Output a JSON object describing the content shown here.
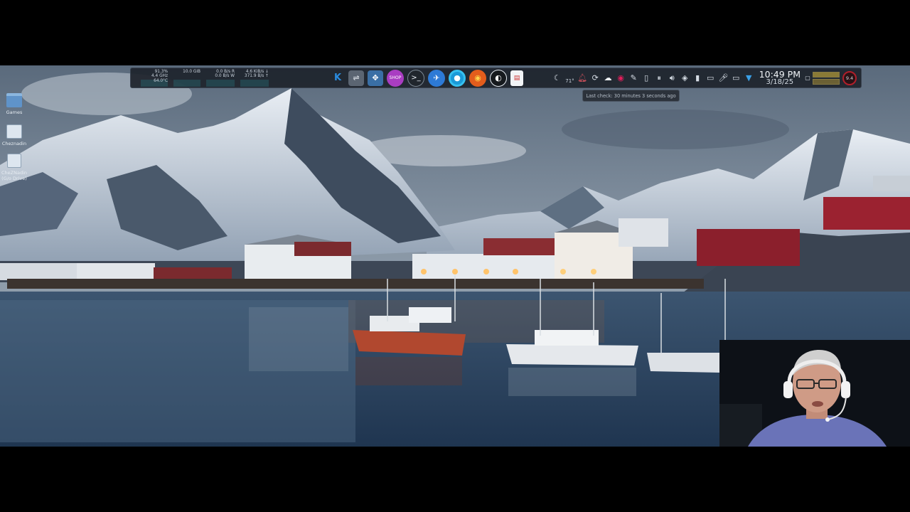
{
  "panel": {
    "system_monitor": {
      "cpu": {
        "usage": "91.3%",
        "freq": "4.4 GHz",
        "temp": "64.0°C"
      },
      "memory": {
        "used": "10.0 GiB"
      },
      "disk": {
        "read": "0.0 B/s R",
        "write": "0.0 B/s W"
      },
      "network": {
        "down": "4.6 KiB/s ↓",
        "up": "371.9 B/s ↑"
      }
    },
    "launchers": [
      {
        "name": "kde-menu",
        "glyph": "K"
      },
      {
        "name": "settings-sliders",
        "glyph": "⇌"
      },
      {
        "name": "window-move",
        "glyph": "✥"
      },
      {
        "name": "shop",
        "glyph": "SHOP"
      },
      {
        "name": "terminal",
        "glyph": ">_"
      },
      {
        "name": "dolphin-files",
        "glyph": "✈"
      },
      {
        "name": "chrome",
        "glyph": "●"
      },
      {
        "name": "firefox",
        "glyph": "◉"
      },
      {
        "name": "obs",
        "glyph": "◐"
      },
      {
        "name": "document-viewer",
        "glyph": "▤"
      }
    ],
    "weather": {
      "temp": "71°",
      "icon": "weather-icon"
    },
    "tray_icons": [
      "bell-icon",
      "update-icon",
      "cloud-icon",
      "record-icon",
      "color-picker-icon",
      "clipboard-icon",
      "pause-icon",
      "volume-icon",
      "vpn-icon",
      "usb-icon",
      "phone-icon",
      "microphone-icon",
      "display-icon",
      "expand-tray-icon"
    ],
    "clock": {
      "time": "10:49 PM",
      "date": "3/18/25"
    },
    "cpu_badge": "9.4"
  },
  "tooltip": {
    "text": "Last check: 30 minutes 3 seconds ago"
  },
  "desktop_icons": [
    {
      "label": "Games"
    },
    {
      "label": "Cheznadin"
    },
    {
      "label": "CheZNadin (G/o Drive)"
    }
  ],
  "colors": {
    "panel_bg": "#1e242c",
    "accent": "#2a8ce0",
    "record": "#e01e5a",
    "cpu_badge_ring": "#b11f2a"
  }
}
